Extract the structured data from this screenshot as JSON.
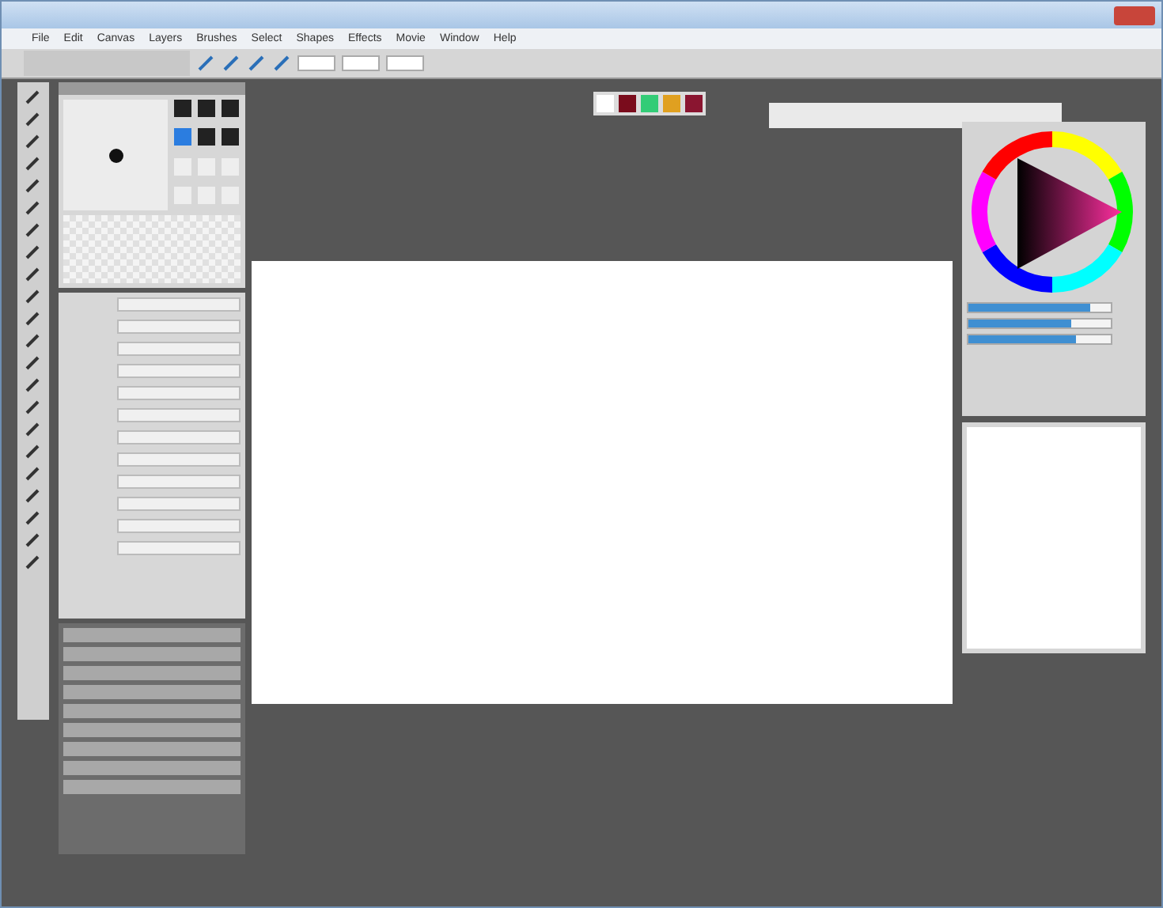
{
  "menu": [
    "File",
    "Edit",
    "Canvas",
    "Layers",
    "Brushes",
    "Select",
    "Shapes",
    "Effects",
    "Movie",
    "Window",
    "Help"
  ],
  "color_sliders": [
    {
      "level": 0.85
    },
    {
      "level": 0.72
    },
    {
      "level": 0.76
    }
  ]
}
